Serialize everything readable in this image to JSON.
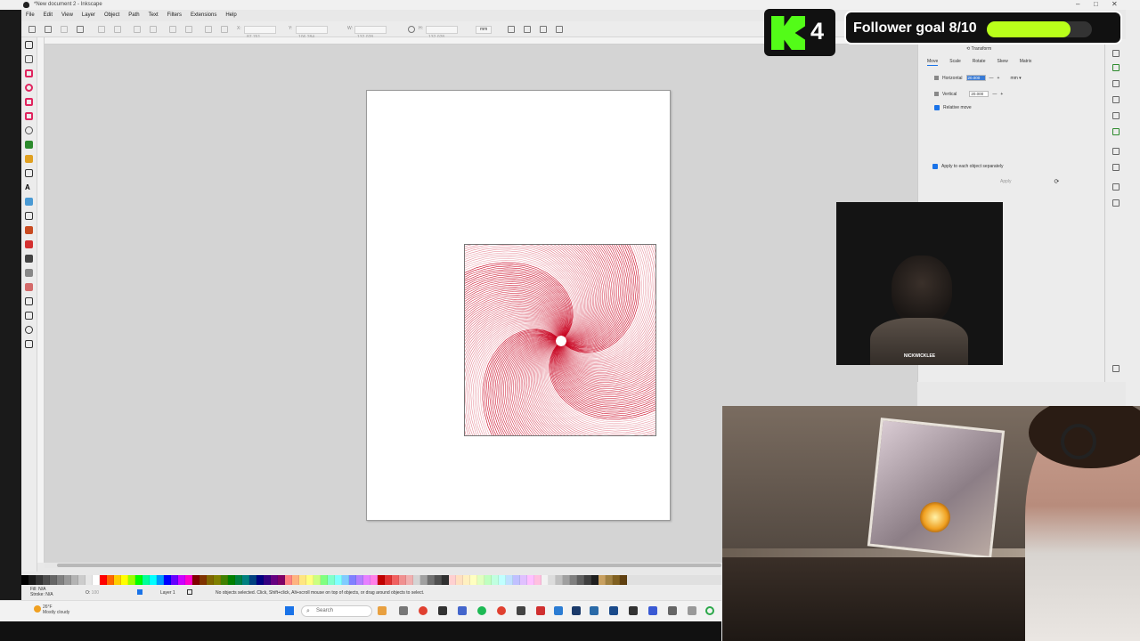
{
  "window": {
    "title": "*New document 2 - Inkscape"
  },
  "menubar": [
    "File",
    "Edit",
    "View",
    "Layer",
    "Object",
    "Path",
    "Text",
    "Filters",
    "Extensions",
    "Help"
  ],
  "toolbar": {
    "x_label": "X:",
    "x_value": "87.761",
    "y_label": "Y:",
    "y_value": "106.284",
    "w_label": "W:",
    "w_value": "132.028",
    "h_label": "H:",
    "h_value": "132.028",
    "unit": "mm"
  },
  "transform_docker": {
    "title": "Transform",
    "tabs": [
      "Move",
      "Scale",
      "Rotate",
      "Skew",
      "Matrix"
    ],
    "active_tab": "Move",
    "horizontal_label": "Horizontal",
    "horizontal_value": "20.000",
    "vertical_label": "Vertical",
    "vertical_value": "20.000",
    "unit": "mm",
    "relative_move_label": "Relative move",
    "apply_each_label": "Apply to each object separately",
    "apply_label": "Apply"
  },
  "statusbar": {
    "fill_label": "Fill:",
    "fill_value": "N/A",
    "stroke_label": "Stroke:",
    "stroke_value": "N/A",
    "opacity_label": "O:",
    "opacity_value": "100",
    "layer": "Layer 1",
    "message": "No objects selected. Click, Shift+click, Alt+scroll mouse on top of objects, or drag around objects to select."
  },
  "taskbar": {
    "weather_temp": "26°F",
    "weather_desc": "Mostly cloudy",
    "search_placeholder": "Search"
  },
  "overlay": {
    "k_count": "4",
    "follower_goal_text": "Follower goal 8/10",
    "follower_progress": 0.8,
    "webcam_name": "NICKWICKLEE"
  },
  "colors": {
    "artwork": "#c8001e",
    "accent": "#1a73e8",
    "kick_green": "#53fc18",
    "goal_bar": "#b9ff1a"
  },
  "palette": [
    "#000000",
    "#1a1a1a",
    "#333333",
    "#4d4d4d",
    "#666666",
    "#808080",
    "#999999",
    "#b3b3b3",
    "#cccccc",
    "#e6e6e6",
    "#ffffff",
    "#ff0000",
    "#ff6600",
    "#ffcc00",
    "#ffff00",
    "#99ff00",
    "#00ff00",
    "#00ff99",
    "#00ffff",
    "#0099ff",
    "#0000ff",
    "#6600ff",
    "#cc00ff",
    "#ff00cc",
    "#800000",
    "#803300",
    "#806600",
    "#808000",
    "#408000",
    "#008000",
    "#008040",
    "#008080",
    "#004080",
    "#000080",
    "#330080",
    "#660080",
    "#800066",
    "#ff8080",
    "#ffb380",
    "#ffe680",
    "#ffff80",
    "#ccff80",
    "#80ff80",
    "#80ffcc",
    "#80ffff",
    "#80ccff",
    "#8080ff",
    "#b380ff",
    "#e680ff",
    "#ff80e6",
    "#c00000",
    "#e03030",
    "#f06060",
    "#f09090",
    "#f0b0b0",
    "#d4d4d4",
    "#a0a0a0",
    "#707070",
    "#505050",
    "#303030",
    "#ffd0d0",
    "#ffe0c0",
    "#fff0c0",
    "#ffffc0",
    "#e0ffc0",
    "#c0ffc0",
    "#c0ffe0",
    "#c0ffff",
    "#c0e0ff",
    "#c0c0ff",
    "#e0c0ff",
    "#ffc0ff",
    "#ffc0e0",
    "#f2f2f2",
    "#dcdcdc",
    "#bfbfbf",
    "#9f9f9f",
    "#7f7f7f",
    "#5f5f5f",
    "#3f3f3f",
    "#1f1f1f",
    "#c8a060",
    "#a08040",
    "#806020",
    "#604010"
  ]
}
